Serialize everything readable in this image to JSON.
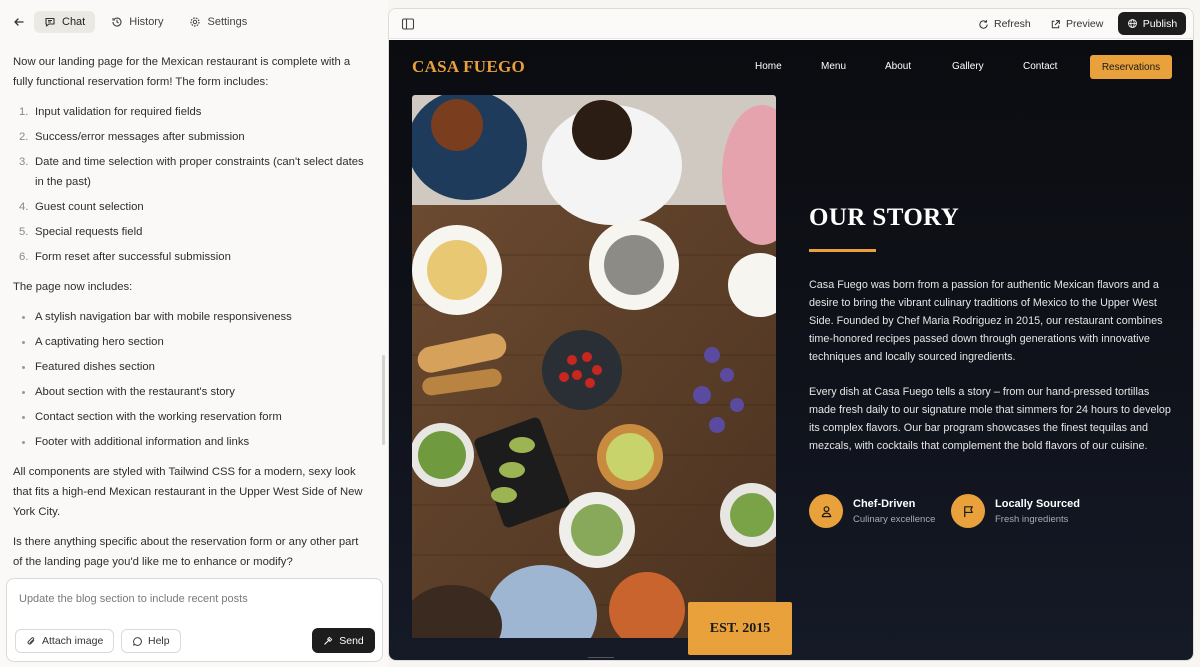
{
  "left_panel": {
    "tabs": [
      {
        "label": "Chat",
        "icon": "chat-bubble-icon",
        "active": true
      },
      {
        "label": "History",
        "icon": "history-icon",
        "active": false
      },
      {
        "label": "Settings",
        "icon": "gear-icon",
        "active": false
      }
    ],
    "message": {
      "intro": "Now our landing page for the Mexican restaurant is complete with a fully functional reservation form! The form includes:",
      "form_features": [
        "Input validation for required fields",
        "Success/error messages after submission",
        "Date and time selection with proper constraints (can't select dates in the past)",
        "Guest count selection",
        "Special requests field",
        "Form reset after successful submission"
      ],
      "page_intro": "The page now includes:",
      "page_features": [
        "A stylish navigation bar with mobile responsiveness",
        "A captivating hero section",
        "Featured dishes section",
        "About section with the restaurant's story",
        "Contact section with the working reservation form",
        "Footer with additional information and links"
      ],
      "summary": "All components are styled with Tailwind CSS for a modern, sexy look that fits a high-end Mexican restaurant in the Upper West Side of New York City.",
      "question": "Is there anything specific about the reservation form or any other part of the landing page you'd like me to enhance or modify?"
    },
    "composer": {
      "placeholder": "Update the blog section to include recent posts",
      "attach_label": "Attach image",
      "help_label": "Help",
      "send_label": "Send"
    }
  },
  "preview_toolbar": {
    "refresh_label": "Refresh",
    "preview_label": "Preview",
    "publish_label": "Publish"
  },
  "site": {
    "brand": "CASA FUEGO",
    "nav": [
      "Home",
      "Menu",
      "About",
      "Gallery",
      "Contact"
    ],
    "cta": "Reservations",
    "badge": "EST. 2015",
    "story": {
      "title": "OUR STORY",
      "p1": "Casa Fuego was born from a passion for authentic Mexican flavors and a desire to bring the vibrant culinary traditions of Mexico to the Upper West Side. Founded by Chef Maria Rodriguez in 2015, our restaurant combines time-honored recipes passed down through generations with innovative techniques and locally sourced ingredients.",
      "p2": "Every dish at Casa Fuego tells a story – from our hand-pressed tortillas made fresh daily to our signature mole that simmers for 24 hours to develop its complex flavors. Our bar program showcases the finest tequilas and mezcals, with cocktails that complement the bold flavors of our cuisine."
    },
    "features": [
      {
        "title": "Chef-Driven",
        "subtitle": "Culinary excellence",
        "icon": "chef-person-icon"
      },
      {
        "title": "Locally Sourced",
        "subtitle": "Fresh ingredients",
        "icon": "flag-icon"
      }
    ],
    "accent_color": "#e9a13b"
  }
}
